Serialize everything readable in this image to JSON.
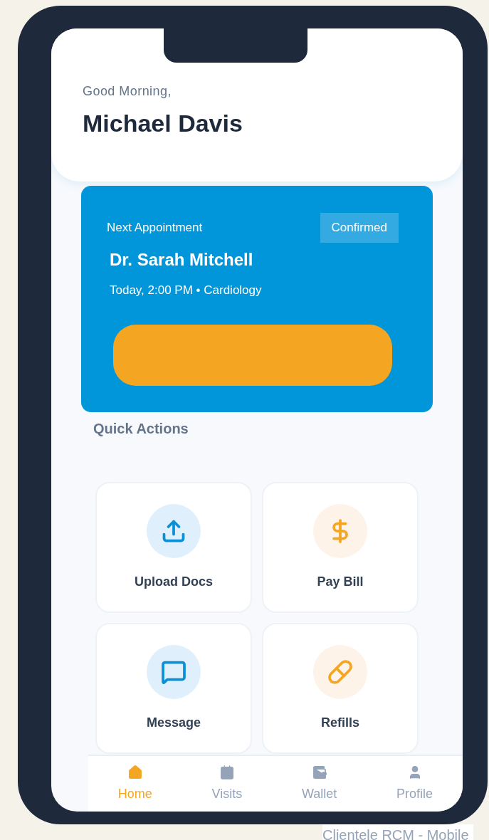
{
  "greeting": {
    "salutation": "Good Morning,",
    "name": "Michael Davis"
  },
  "appointment": {
    "label": "Next Appointment",
    "status": "Confirmed",
    "doctor": "Dr. Sarah Mitchell",
    "details": "Today, 2:00 PM • Cardiology"
  },
  "quick_actions": {
    "title": "Quick Actions",
    "items": [
      {
        "kind": "upload",
        "label": "Upload Docs"
      },
      {
        "kind": "pay",
        "label": "Pay Bill"
      },
      {
        "kind": "message",
        "label": "Message"
      },
      {
        "kind": "refills",
        "label": "Refills"
      }
    ]
  },
  "bottom_nav": [
    {
      "kind": "home",
      "label": "Home",
      "selected": true
    },
    {
      "kind": "visits",
      "label": "Visits",
      "selected": false
    },
    {
      "kind": "wallet",
      "label": "Wallet",
      "selected": false
    },
    {
      "kind": "profile",
      "label": "Profile",
      "selected": false
    }
  ],
  "caption": "Clientele RCM - Mobile"
}
